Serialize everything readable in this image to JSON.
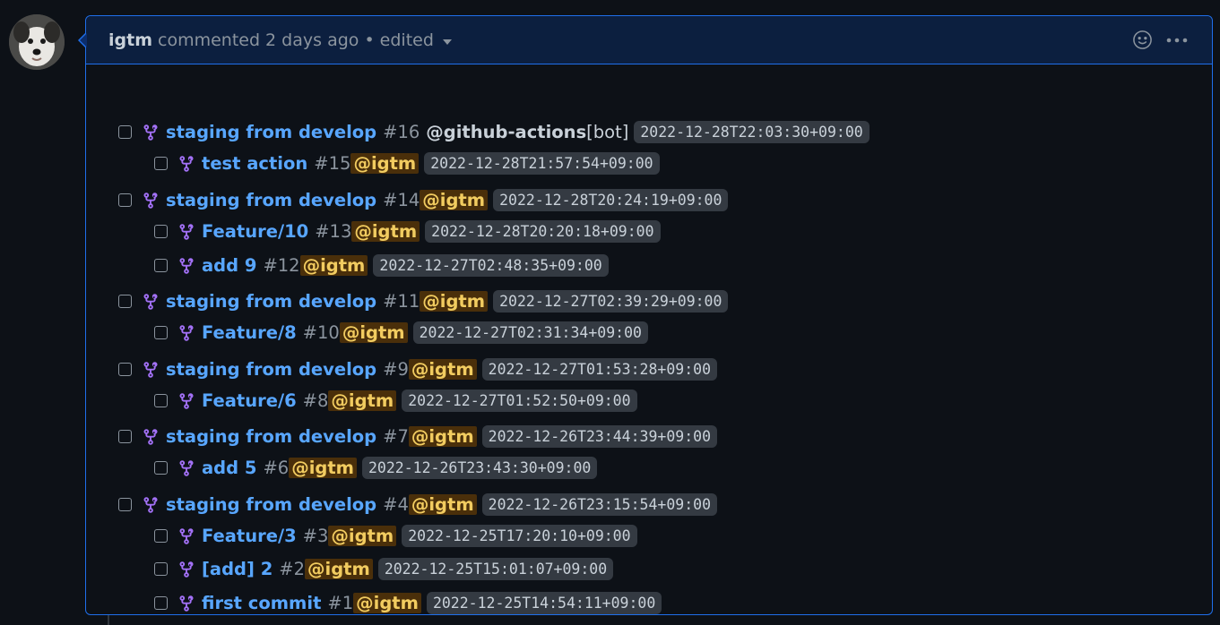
{
  "comment": {
    "author": "igtm",
    "meta_text": "commented 2 days ago • edited",
    "emoji_icon": "smiley-icon",
    "more_icon": "kebab-horizontal-icon"
  },
  "colors": {
    "link": "#58a6ff",
    "mention_bg": "#4a2f0a",
    "mention_fg": "#f2cc60",
    "pr_icon": "#a371f7",
    "border_accent": "#1f6feb"
  },
  "tasks": [
    {
      "level": 0,
      "title": "staging from develop",
      "number": "#16",
      "mention": "@github-actions",
      "suffix": "[bot]",
      "mention_style": "plain",
      "date": "2022-12-28T22:03:30+09:00"
    },
    {
      "level": 1,
      "title": "test action",
      "number": "#15",
      "mention": "@igtm",
      "suffix": "",
      "mention_style": "highlight",
      "date": "2022-12-28T21:57:54+09:00"
    },
    {
      "level": 0,
      "title": "staging from develop",
      "number": "#14",
      "mention": "@igtm",
      "suffix": "",
      "mention_style": "highlight",
      "date": "2022-12-28T20:24:19+09:00"
    },
    {
      "level": 1,
      "title": "Feature/10",
      "number": "#13",
      "mention": "@igtm",
      "suffix": "",
      "mention_style": "highlight",
      "date": "2022-12-28T20:20:18+09:00"
    },
    {
      "level": 1,
      "title": "add 9",
      "number": "#12",
      "mention": "@igtm",
      "suffix": "",
      "mention_style": "highlight",
      "date": "2022-12-27T02:48:35+09:00"
    },
    {
      "level": 0,
      "title": "staging from develop",
      "number": "#11",
      "mention": "@igtm",
      "suffix": "",
      "mention_style": "highlight",
      "date": "2022-12-27T02:39:29+09:00"
    },
    {
      "level": 1,
      "title": "Feature/8",
      "number": "#10",
      "mention": "@igtm",
      "suffix": "",
      "mention_style": "highlight",
      "date": "2022-12-27T02:31:34+09:00"
    },
    {
      "level": 0,
      "title": "staging from develop",
      "number": "#9",
      "mention": "@igtm",
      "suffix": "",
      "mention_style": "highlight",
      "date": "2022-12-27T01:53:28+09:00"
    },
    {
      "level": 1,
      "title": "Feature/6",
      "number": "#8",
      "mention": "@igtm",
      "suffix": "",
      "mention_style": "highlight",
      "date": "2022-12-27T01:52:50+09:00"
    },
    {
      "level": 0,
      "title": "staging from develop",
      "number": "#7",
      "mention": "@igtm",
      "suffix": "",
      "mention_style": "highlight",
      "date": "2022-12-26T23:44:39+09:00"
    },
    {
      "level": 1,
      "title": "add 5",
      "number": "#6",
      "mention": "@igtm",
      "suffix": "",
      "mention_style": "highlight",
      "date": "2022-12-26T23:43:30+09:00"
    },
    {
      "level": 0,
      "title": "staging from develop",
      "number": "#4",
      "mention": "@igtm",
      "suffix": "",
      "mention_style": "highlight",
      "date": "2022-12-26T23:15:54+09:00"
    },
    {
      "level": 1,
      "title": "Feature/3",
      "number": "#3",
      "mention": "@igtm",
      "suffix": "",
      "mention_style": "highlight",
      "date": "2022-12-25T17:20:10+09:00"
    },
    {
      "level": 1,
      "title": "[add] 2",
      "number": "#2",
      "mention": "@igtm",
      "suffix": "",
      "mention_style": "highlight",
      "date": "2022-12-25T15:01:07+09:00"
    },
    {
      "level": 1,
      "title": "first commit",
      "number": "#1",
      "mention": "@igtm",
      "suffix": "",
      "mention_style": "highlight",
      "date": "2022-12-25T14:54:11+09:00"
    }
  ]
}
